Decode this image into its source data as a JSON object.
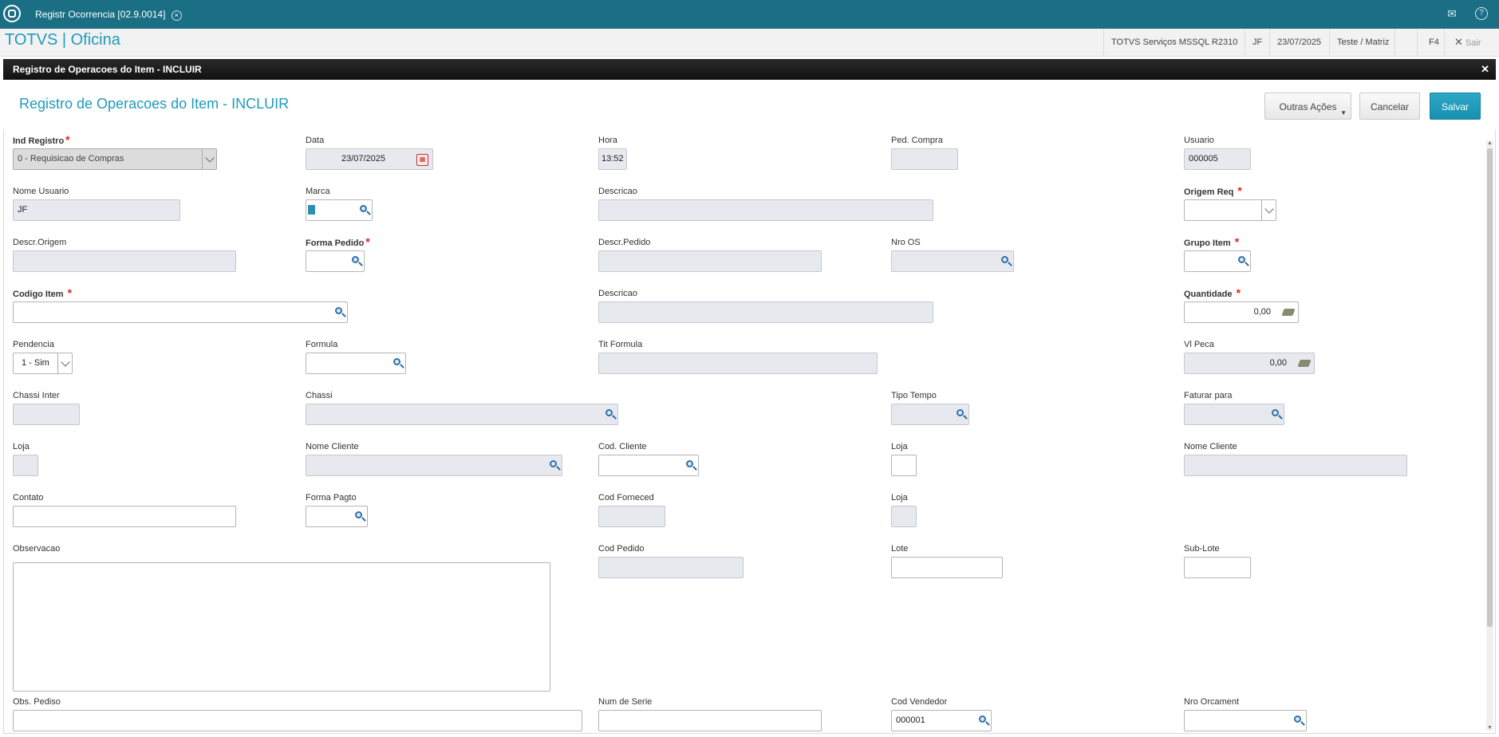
{
  "window": {
    "tab_title": "Registr Ocorrencia [02.9.0014]"
  },
  "app": {
    "title": "TOTVS | Oficina",
    "status": {
      "server": "TOTVS Serviços MSSQL R2310",
      "user": "JF",
      "date": "23/07/2025",
      "branch": "Teste / Matriz",
      "shortcut": "F4",
      "exit_label": "Sair"
    }
  },
  "dialog": {
    "bar_title": "Registro de Operacoes do Item - INCLUIR",
    "title": "Registro de Operacoes do Item - INCLUIR",
    "buttons": {
      "more": "Outras Ações",
      "cancel": "Cancelar",
      "save": "Salvar"
    }
  },
  "form": {
    "ind_registro": {
      "label": "Ind Registro",
      "value": "0 - Requisicao de Compras"
    },
    "data": {
      "label": "Data",
      "value": "23/07/2025"
    },
    "hora": {
      "label": "Hora",
      "value": "13:52"
    },
    "ped_compra": {
      "label": "Ped. Compra",
      "value": ""
    },
    "usuario": {
      "label": "Usuario",
      "value": "000005"
    },
    "nome_usuario": {
      "label": "Nome Usuario",
      "value": "JF"
    },
    "marca": {
      "label": "Marca",
      "value": ""
    },
    "descricao1": {
      "label": "Descricao",
      "value": ""
    },
    "origem_req": {
      "label": "Origem Req",
      "value": ""
    },
    "descr_origem": {
      "label": "Descr.Origem",
      "value": ""
    },
    "forma_pedido": {
      "label": "Forma Pedido",
      "value": ""
    },
    "descr_pedido": {
      "label": "Descr.Pedido",
      "value": ""
    },
    "nro_os": {
      "label": "Nro OS",
      "value": ""
    },
    "grupo_item": {
      "label": "Grupo Item",
      "value": ""
    },
    "codigo_item": {
      "label": "Codigo Item",
      "value": ""
    },
    "descricao2": {
      "label": "Descricao",
      "value": ""
    },
    "quantidade": {
      "label": "Quantidade",
      "value": "0,00"
    },
    "pendencia": {
      "label": "Pendencia",
      "value": "1 - Sim"
    },
    "formula": {
      "label": "Formula",
      "value": ""
    },
    "tit_formula": {
      "label": "Tit Formula",
      "value": ""
    },
    "vl_peca": {
      "label": "Vl Peca",
      "value": "0,00"
    },
    "chassi_inter": {
      "label": "Chassi Inter",
      "value": ""
    },
    "chassi": {
      "label": "Chassi",
      "value": ""
    },
    "tipo_tempo": {
      "label": "Tipo Tempo",
      "value": ""
    },
    "faturar_para": {
      "label": "Faturar para",
      "value": ""
    },
    "loja1": {
      "label": "Loja",
      "value": ""
    },
    "nome_cliente1": {
      "label": "Nome Cliente",
      "value": ""
    },
    "cod_cliente": {
      "label": "Cod. Cliente",
      "value": ""
    },
    "loja2": {
      "label": "Loja",
      "value": ""
    },
    "nome_cliente2": {
      "label": "Nome Cliente",
      "value": ""
    },
    "contato": {
      "label": "Contato",
      "value": ""
    },
    "forma_pagto": {
      "label": "Forma Pagto",
      "value": ""
    },
    "cod_forneced": {
      "label": "Cod Forneced",
      "value": ""
    },
    "loja3": {
      "label": "Loja",
      "value": ""
    },
    "observacao": {
      "label": "Observacao",
      "value": ""
    },
    "cod_pedido": {
      "label": "Cod Pedido",
      "value": ""
    },
    "lote": {
      "label": "Lote",
      "value": ""
    },
    "sub_lote": {
      "label": "Sub-Lote",
      "value": ""
    },
    "obs_pedido": {
      "label": "Obs. Pediso",
      "value": ""
    },
    "num_serie": {
      "label": "Num de Serie",
      "value": ""
    },
    "cod_vendedor": {
      "label": "Cod Vendedor",
      "value": "000001"
    },
    "nro_orcament": {
      "label": "Nro Orcament",
      "value": ""
    }
  },
  "colors": {
    "header": "#1a6f84",
    "accent": "#1e9bbd",
    "required": "#e02020"
  }
}
